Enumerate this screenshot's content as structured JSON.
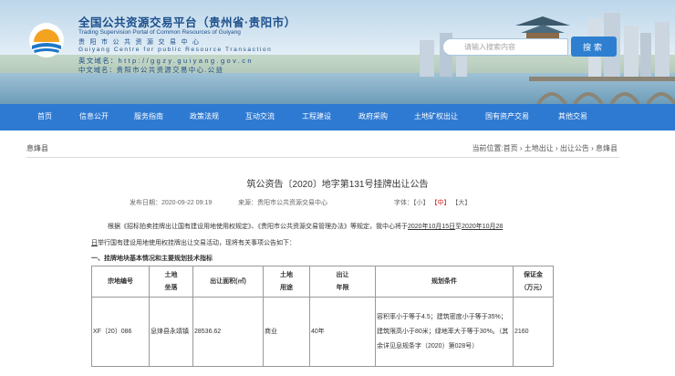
{
  "header": {
    "title": "全国公共资源交易平台（贵州省·贵阳市）",
    "subtitle": "Trading Supervision Portal of Common Resources of Guiyang",
    "cn_name": "贵阳市公共资源交易中心",
    "en_name": "Guiyang Centre for public Resource Transaction",
    "domain_en_label": "英文域名：",
    "domain_en_value": "http://ggzy.guiyang.gov.cn",
    "domain_cn_label": "中文域名：",
    "domain_cn_value": "贵阳市公共资源交易中心.公益"
  },
  "search": {
    "placeholder": "请输入搜索内容",
    "button_label": "搜索"
  },
  "nav": {
    "items": [
      "首页",
      "信息公开",
      "服务指南",
      "政策法规",
      "互动交流",
      "工程建设",
      "政府采购",
      "土地矿权出让",
      "国有资产交易",
      "其他交易"
    ]
  },
  "breadcrumb": {
    "section": "息烽县",
    "path": "当前位置:首页 › 土地出让 › 出让公告 › 息烽县"
  },
  "article": {
    "title": "筑公资告〔2020〕地字第131号挂牌出让公告",
    "publish_time": "发布日期：2020-09-22 09:19",
    "source": "来源：贵阳市公共资源交易中心",
    "font_size_label": "字体：",
    "font_small": "【小】",
    "font_medium": "【中】",
    "font_large": "【大】",
    "para1_pre": "根据《招标拍卖挂牌出让国有建设用地使用权规定》、《贵阳市公共资源交易管理办法》等规定，我中心将于",
    "para1_date1": "2020年10月15日",
    "para1_mid": "至",
    "para1_date2": "2020年10月28",
    "para2_date": "日",
    "para2_rest": "举行国有建设用地使用权挂牌出让交易活动，现将有关事项公告如下：",
    "section_heading": "一、挂牌地块基本情况和主要规划技术指标"
  },
  "table": {
    "headers": [
      "宗地编号",
      "土地\n坐落",
      "出让面积(㎡)",
      "土地\n用途",
      "出让\n年限",
      "规划条件",
      "保证金\n（万元）"
    ],
    "rows": [
      [
        "XF〔20〕086",
        "息烽县永靖镇",
        "28536.62",
        "商业",
        "40年",
        "容积率小于等于4.5；建筑密度小于等于35%；建筑限高小于80米；绿地率大于等于30%。（其余详见息规条字（2020）第028号）",
        "2160"
      ]
    ]
  },
  "colors": {
    "nav_bg": "#2e7ad3",
    "search_button": "#2f7fd0",
    "highlight_red": "#d0221f",
    "title_blue": "#1d4f8c"
  }
}
